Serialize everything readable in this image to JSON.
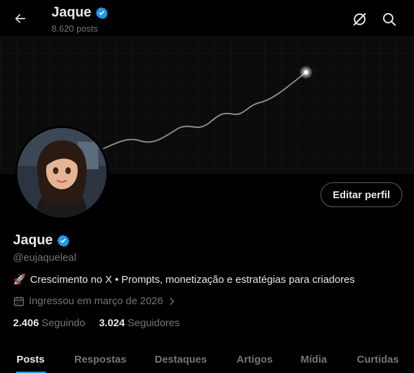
{
  "header": {
    "name": "Jaque",
    "posts": "8.620 posts",
    "back_icon": "arrow-left-icon",
    "grok_icon": "grok-icon",
    "search_icon": "search-icon"
  },
  "profile": {
    "name": "Jaque",
    "handle": "@eujaqueleal",
    "bio_emoji": "🚀",
    "bio": "Crescimento no X • Prompts, monetização e estratégias para criadores",
    "joined": "Ingressou em março de 2026",
    "following_count": "2.406",
    "following_label": "Seguindo",
    "followers_count": "3.024",
    "followers_label": "Seguidores",
    "edit_button": "Editar perfil",
    "verified_color": "#1d9bf0"
  },
  "tabs": [
    {
      "label": "Posts",
      "active": true
    },
    {
      "label": "Respostas",
      "active": false
    },
    {
      "label": "Destaques",
      "active": false
    },
    {
      "label": "Artigos",
      "active": false
    },
    {
      "label": "Mídia",
      "active": false
    },
    {
      "label": "Curtidas",
      "active": false
    }
  ],
  "colors": {
    "background": "#000000",
    "text_primary": "#e7e9ea",
    "text_secondary": "#71767b",
    "accent": "#1d9bf0"
  }
}
